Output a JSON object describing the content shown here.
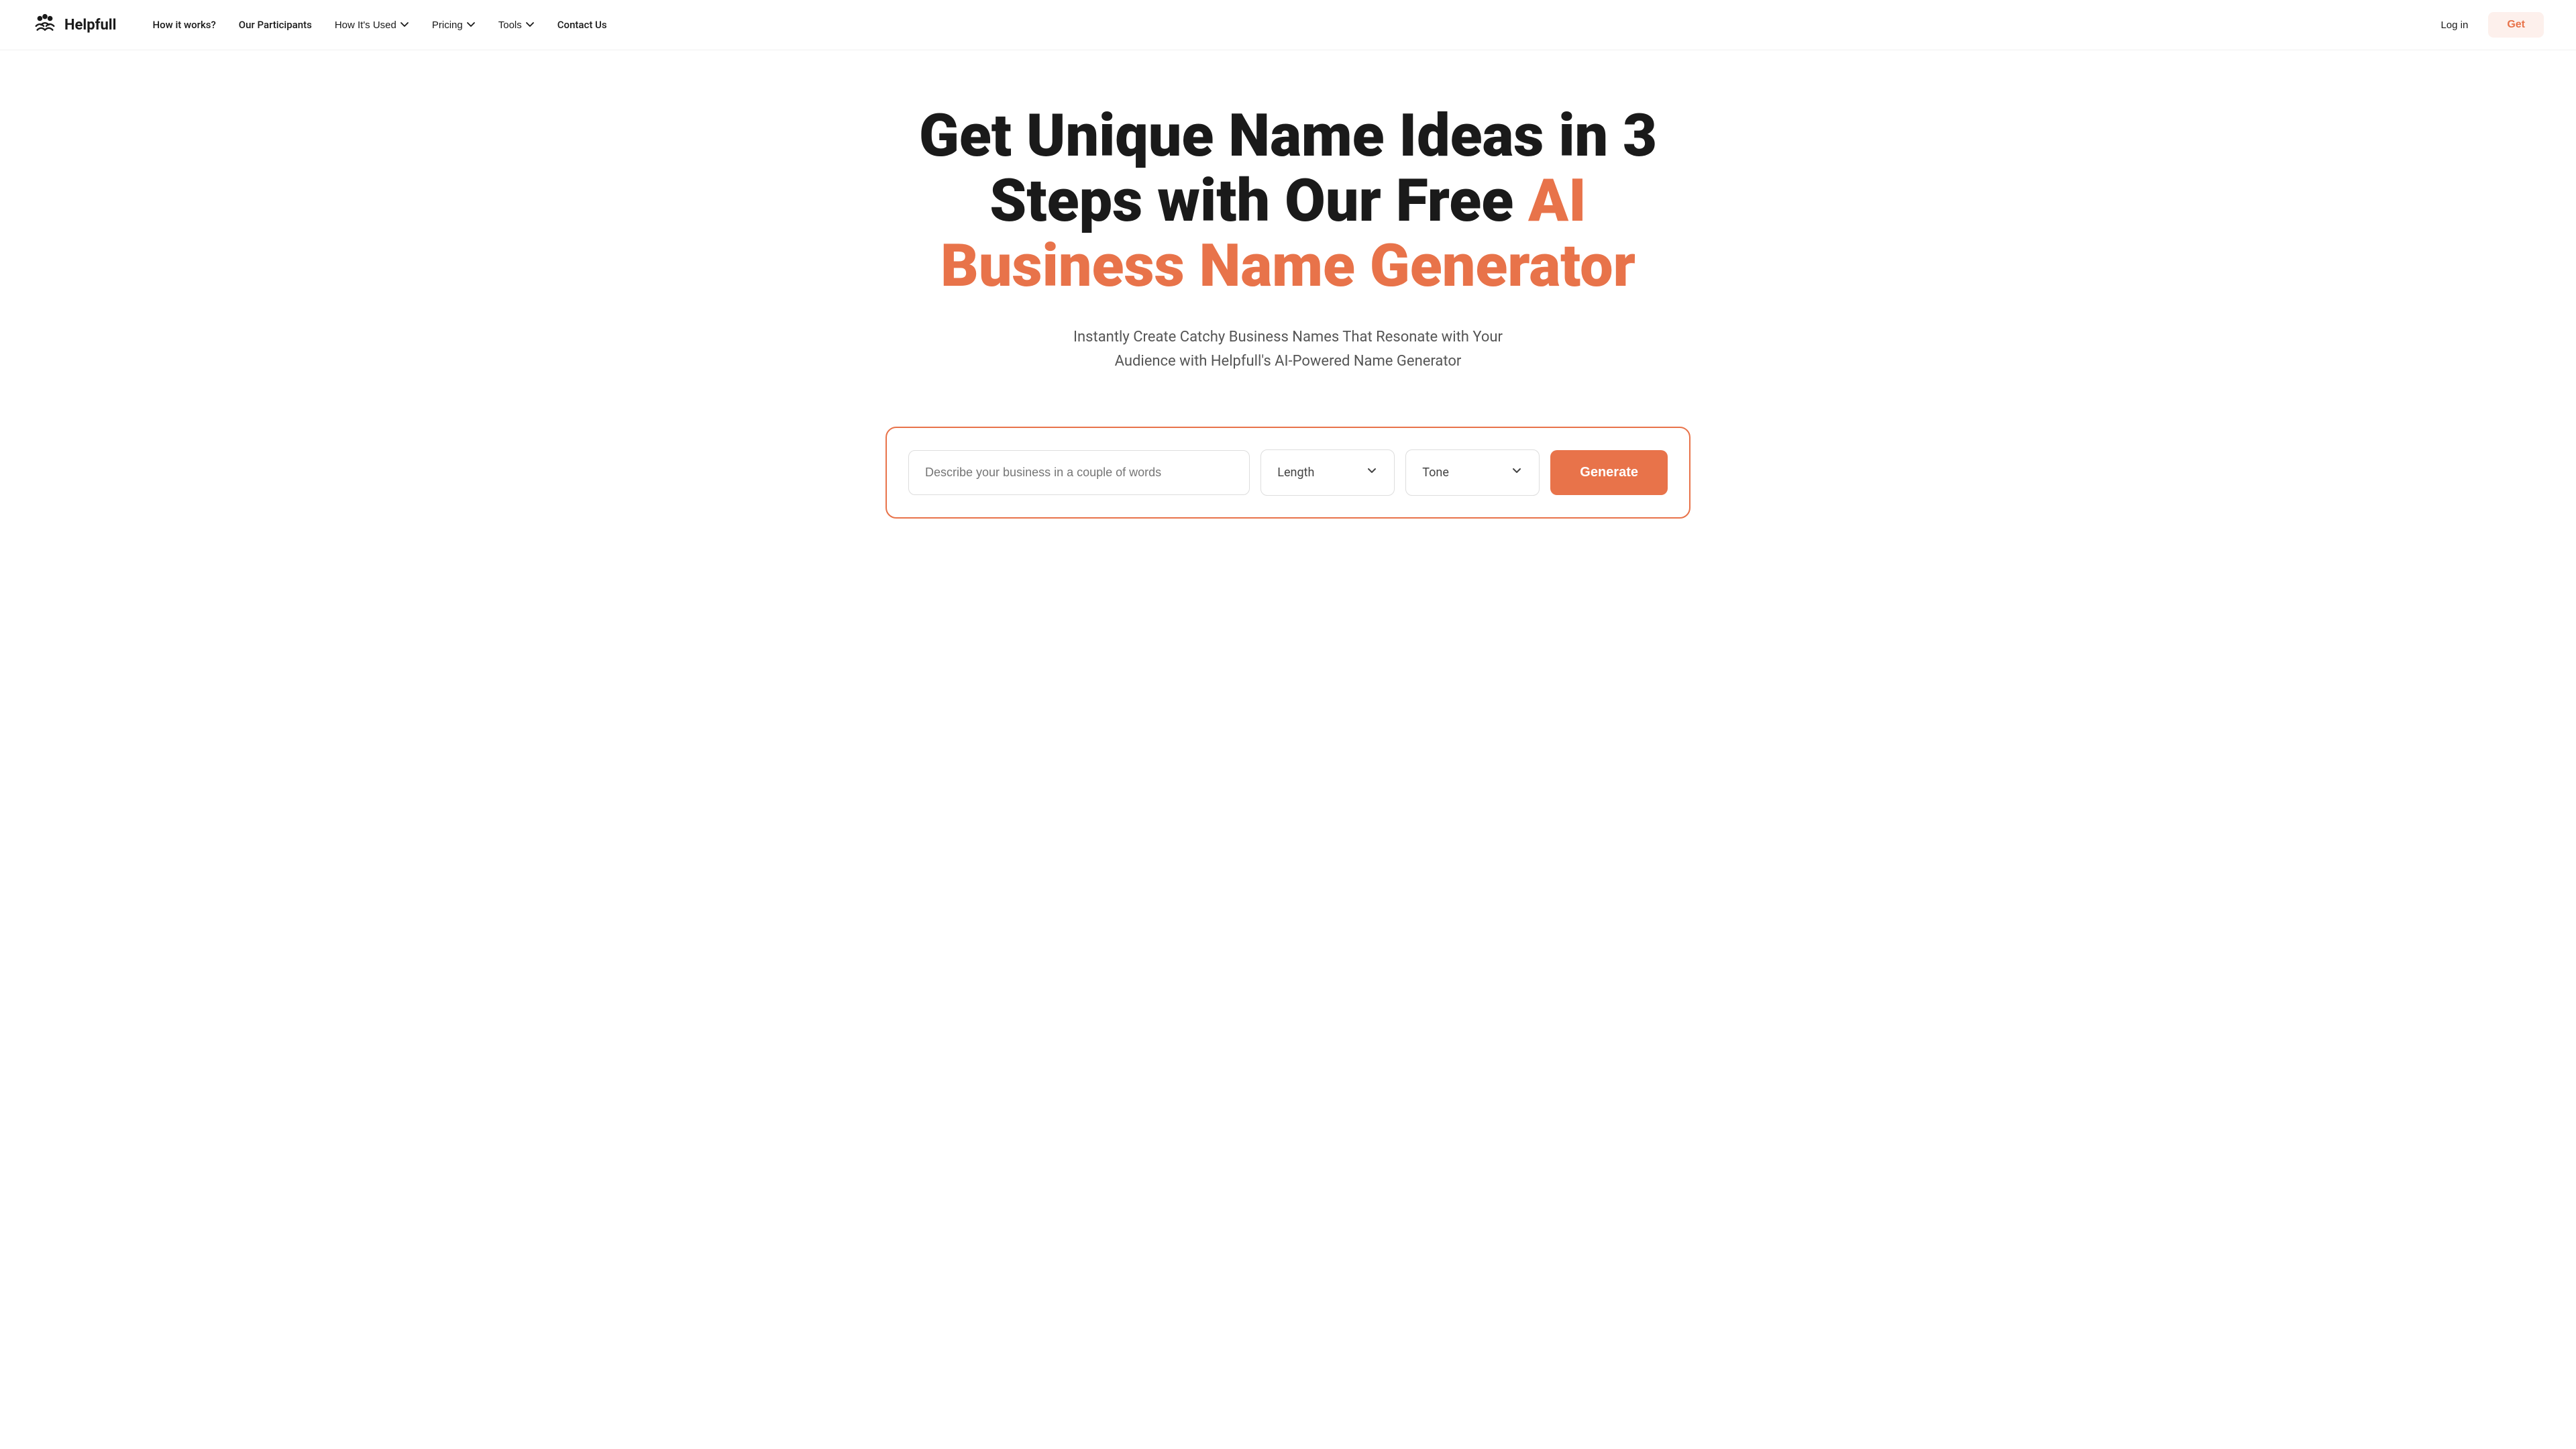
{
  "brand": {
    "name": "Helpfull",
    "logo_alt": "Helpfull logo"
  },
  "nav": {
    "links": [
      {
        "id": "how-it-works",
        "label": "How it works?",
        "hasDropdown": false
      },
      {
        "id": "our-participants",
        "label": "Our Participants",
        "hasDropdown": false
      },
      {
        "id": "how-its-used",
        "label": "How It's Used",
        "hasDropdown": true
      },
      {
        "id": "pricing",
        "label": "Pricing",
        "hasDropdown": true
      },
      {
        "id": "tools",
        "label": "Tools",
        "hasDropdown": true
      },
      {
        "id": "contact-us",
        "label": "Contact Us",
        "hasDropdown": false
      }
    ],
    "login_label": "Log in",
    "get_label": "Get"
  },
  "hero": {
    "title_line1": "Get Unique Name Ideas in 3",
    "title_line2": "Steps with Our Free ",
    "title_accent": "AI",
    "title_line3": "Business Name Generator",
    "subtitle": "Instantly Create Catchy Business Names That Resonate with Your Audience with Helpfull's AI-Powered Name Generator"
  },
  "form": {
    "input_placeholder": "Describe your business in a couple of words",
    "length_label": "Length",
    "tone_label": "Tone",
    "generate_label": "Generate"
  },
  "colors": {
    "accent": "#e8734a",
    "accent_light": "#fdf0ec"
  }
}
